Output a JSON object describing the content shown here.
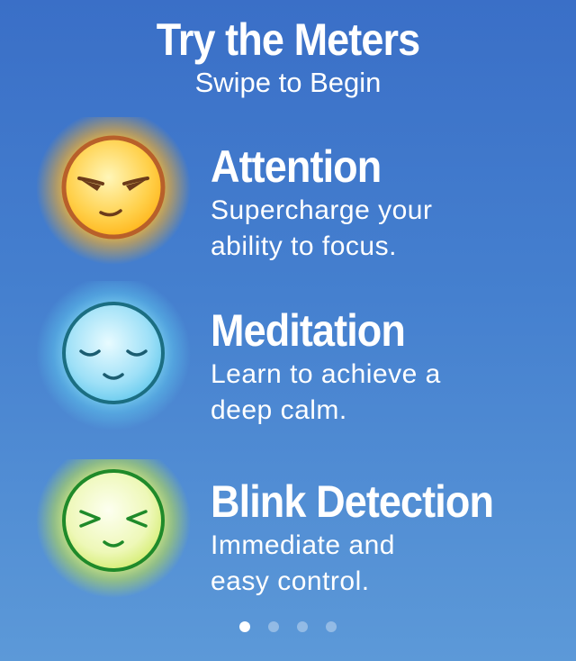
{
  "header": {
    "title": "Try the Meters",
    "subtitle": "Swipe to Begin"
  },
  "meters": [
    {
      "title": "Attention",
      "desc_line1": "Supercharge your",
      "desc_line2": "ability to focus.",
      "icon": "determined-face-icon",
      "color": "#f5a623"
    },
    {
      "title": "Meditation",
      "desc_line1": "Learn to achieve a",
      "desc_line2": "deep calm.",
      "icon": "calm-face-icon",
      "color": "#5bc8ec"
    },
    {
      "title": "Blink Detection",
      "desc_line1": "Immediate and",
      "desc_line2": "easy control.",
      "icon": "squinting-face-icon",
      "color": "#c8e84a"
    }
  ],
  "pager": {
    "count": 4,
    "active_index": 0
  }
}
